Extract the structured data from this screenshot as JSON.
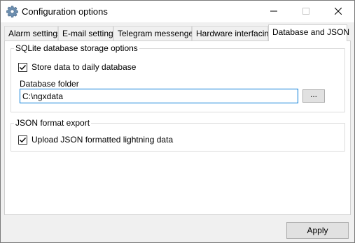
{
  "window": {
    "title": "Configuration options",
    "icon": "gear-icon"
  },
  "tabs": [
    {
      "label": "Alarm settings"
    },
    {
      "label": "E-mail settings"
    },
    {
      "label": "Telegram messenger"
    },
    {
      "label": "Hardware interfacing"
    },
    {
      "label": "Database and JSON",
      "active": true
    }
  ],
  "sqlite_group": {
    "title": "SQLite database storage options",
    "store_daily_label": "Store data to daily database",
    "store_daily_checked": true,
    "folder_label": "Database folder",
    "folder_value": "C:\\ngxdata",
    "browse_label": "..."
  },
  "json_group": {
    "title": "JSON format export",
    "upload_label": "Upload JSON formatted lightning data",
    "upload_checked": true
  },
  "footer": {
    "apply_label": "Apply"
  },
  "colors": {
    "accent_border": "#0078d7",
    "button_bg": "#e1e1e1"
  }
}
